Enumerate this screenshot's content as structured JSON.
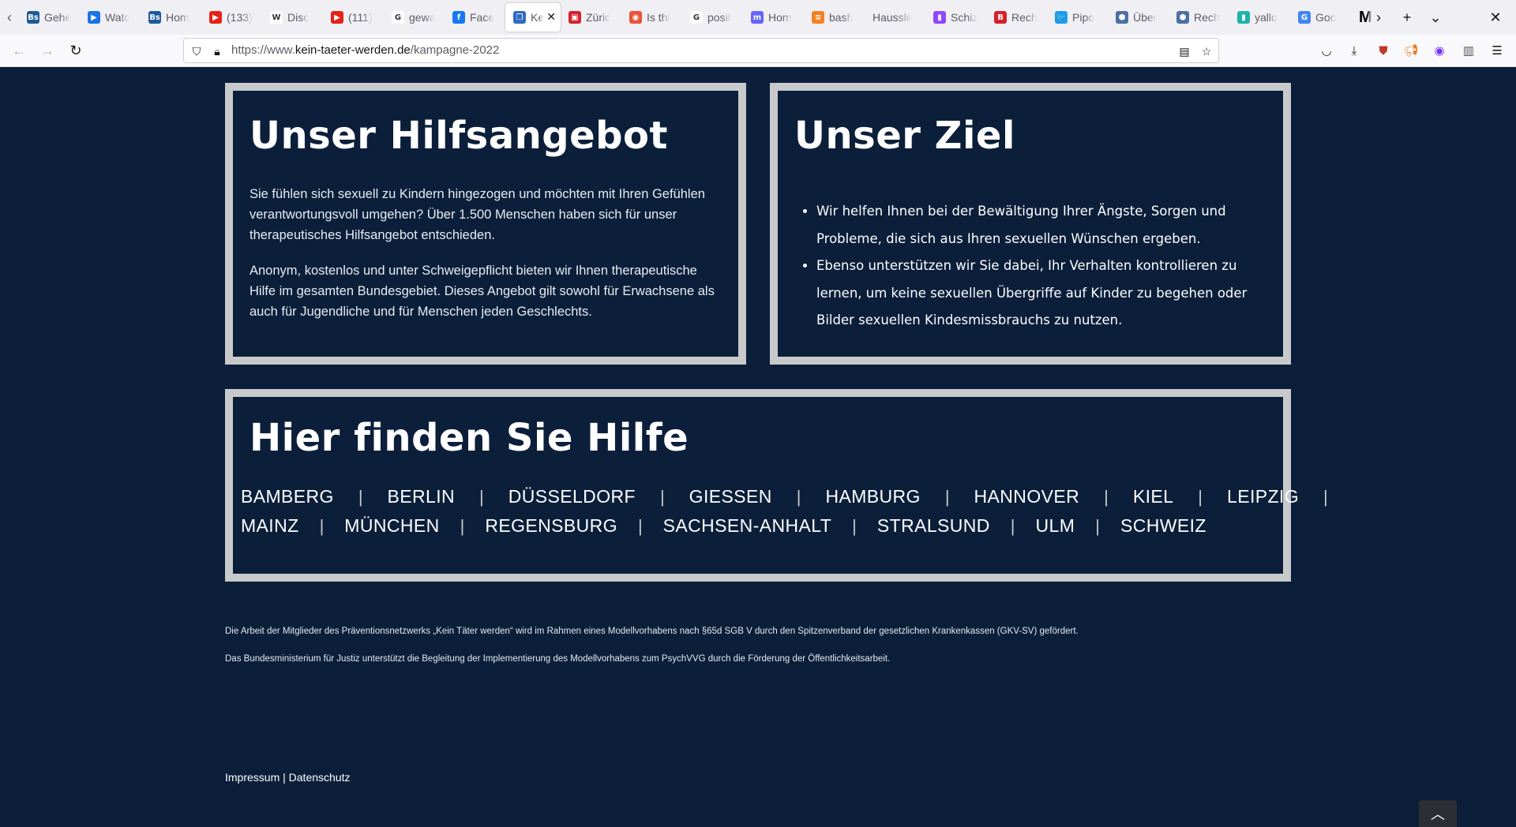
{
  "browser": {
    "tabs": [
      {
        "label": "Gehe",
        "icon": "Bs",
        "color": "#1d5b9a"
      },
      {
        "label": "Watc",
        "icon": "▶",
        "color": "#1a73e8"
      },
      {
        "label": "Hom",
        "icon": "Bs",
        "color": "#1d5b9a"
      },
      {
        "label": "(133)",
        "icon": "▶",
        "color": "#e62117"
      },
      {
        "label": "Disc",
        "icon": "W",
        "color": "#ffffff"
      },
      {
        "label": "(111)",
        "icon": "▶",
        "color": "#e62117"
      },
      {
        "label": "gewa",
        "icon": "G",
        "color": "#ffffff"
      },
      {
        "label": "Face",
        "icon": "f",
        "color": "#1877f2"
      },
      {
        "label": "Ke",
        "icon": "❐",
        "color": "#2d6cc0",
        "active": true
      },
      {
        "label": "Züric",
        "icon": "▣",
        "color": "#d6202c"
      },
      {
        "label": "Is thi",
        "icon": "◉",
        "color": "#e8533b"
      },
      {
        "label": "posit",
        "icon": "G",
        "color": "#ffffff"
      },
      {
        "label": "Hom",
        "icon": "m",
        "color": "#6364ff"
      },
      {
        "label": "bash",
        "icon": "≡",
        "color": "#f48024"
      },
      {
        "label": "Haussle",
        "icon": "",
        "color": "#f0f0f4"
      },
      {
        "label": "Schiz",
        "icon": "▮",
        "color": "#9146ff"
      },
      {
        "label": "Rech",
        "icon": "B",
        "color": "#d6202c"
      },
      {
        "label": "Pipo",
        "icon": "🐦",
        "color": "#1d9bf0"
      },
      {
        "label": "Über",
        "icon": "⬢",
        "color": "#4a6fa5"
      },
      {
        "label": "Rech",
        "icon": "⬢",
        "color": "#4a6fa5"
      },
      {
        "label": "yallo",
        "icon": "▮",
        "color": "#20b2aa"
      },
      {
        "label": "Goo",
        "icon": "G",
        "color": "#4285f4"
      },
      {
        "label": "M",
        "icon": "",
        "color": "#f0f0f4"
      }
    ],
    "url_prefix": "https://www.",
    "url_domain": "kein-taeter-werden.de",
    "url_path": "/kampagne-2022"
  },
  "offer": {
    "title": "Unser Hilfsangebot",
    "paragraphs": [
      "Sie fühlen sich sexuell zu Kindern hingezogen und möchten mit Ihren Gefühlen verantwortungsvoll umgehen? Über 1.500 Menschen haben sich für unser therapeutisches Hilfsangebot entschieden.",
      "Anonym, kostenlos und unter Schweigepflicht bieten wir Ihnen therapeutische Hilfe im gesamten Bundesgebiet. Dieses Angebot gilt sowohl für Erwachsene als auch für Jugendliche und für Menschen jeden Geschlechts."
    ]
  },
  "goal": {
    "title": "Unser Ziel",
    "bullets": [
      "Wir helfen Ihnen bei der Bewältigung Ihrer Ängste, Sorgen und Probleme, die sich aus Ihren sexuellen Wünschen ergeben.",
      "Ebenso unterstützen wir Sie dabei, Ihr Verhalten kontrollieren zu lernen, um keine sexuellen Übergriffe auf Kinder zu begehen oder Bilder sexuellen Kindesmissbrauchs zu nutzen."
    ]
  },
  "help": {
    "title": "Hier finden Sie Hilfe",
    "row1": [
      "BAMBERG",
      "BERLIN",
      "DÜSSELDORF",
      "GIESSEN",
      "HAMBURG",
      "HANNOVER",
      "KIEL",
      "LEIPZIG"
    ],
    "row2": [
      "MAINZ",
      "MÜNCHEN",
      "REGENSBURG",
      "SACHSEN-ANHALT",
      "STRALSUND",
      "ULM",
      "SCHWEIZ"
    ],
    "separator": "|"
  },
  "footer": {
    "note1": "Die Arbeit der Mitglieder des Präventionsnetzwerks „Kein Täter werden“ wird im Rahmen eines Modellvorhabens nach §65d SGB V durch den Spitzenverband der gesetzlichen Krankenkassen (GKV-SV) gefördert.",
    "note2": "Das Bundesministerium für Justiz unterstützt die Begleitung der Implementierung des Modellvorhabens zum PsychVVG durch die Förderung der Öffentlichkeitsarbeit.",
    "impressum": "Impressum",
    "divider": "|",
    "datenschutz": "Datenschutz"
  }
}
